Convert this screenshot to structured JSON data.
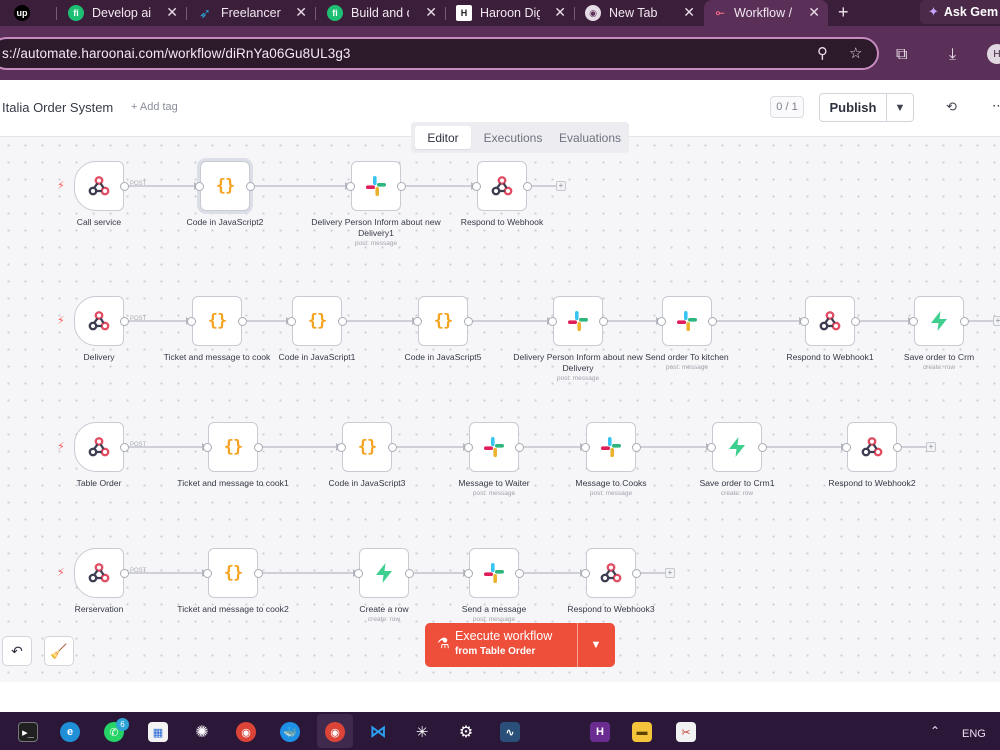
{
  "browser": {
    "tabs": [
      {
        "label": "",
        "icon": "upwork-icon",
        "favicon_text": "up"
      },
      {
        "label": "Develop ai",
        "icon": "fiverr-icon",
        "favicon_text": "fi"
      },
      {
        "label": "Freelancer",
        "icon": "freelancer-icon",
        "favicon_text": ""
      },
      {
        "label": "Build and d",
        "icon": "fiverr-icon",
        "favicon_text": "fi"
      },
      {
        "label": "Haroon Dig",
        "icon": "haroon-icon",
        "favicon_text": "H"
      },
      {
        "label": "New Tab",
        "icon": "chrome-icon",
        "favicon_text": ""
      },
      {
        "label": "Workflow /",
        "icon": "n8n-icon",
        "favicon_text": "",
        "active": true
      }
    ],
    "ask_gemini": "Ask Gem",
    "url": "s://automate.haroonai.com/workflow/diRnYa06Gu8UL3g3",
    "profile_initial": "H"
  },
  "header": {
    "workflow_name": "Italia Order System",
    "add_tag": "+ Add tag",
    "counter": "0 / 1",
    "publish": "Publish",
    "tabs": [
      "Editor",
      "Executions",
      "Evaluations"
    ],
    "active_tab": "Editor"
  },
  "workflow": {
    "edge_label": "POST",
    "nodes": [
      {
        "id": "n1",
        "label": "Call service",
        "type": "webhook",
        "trigger": true
      },
      {
        "id": "n2",
        "label": "Code in JavaScript2",
        "type": "code",
        "selected": true
      },
      {
        "id": "n3",
        "label": "Delivery Person Inform about new Delivery1",
        "type": "slack",
        "sub": "post: message"
      },
      {
        "id": "n4",
        "label": "Respond to Webhook",
        "type": "webhook"
      },
      {
        "id": "n5",
        "label": "Delivery",
        "type": "webhook",
        "trigger": true
      },
      {
        "id": "n6",
        "label": "Ticket and message to cook",
        "type": "code"
      },
      {
        "id": "n7",
        "label": "Code in JavaScript1",
        "type": "code"
      },
      {
        "id": "n8",
        "label": "Code in JavaScript5",
        "type": "code"
      },
      {
        "id": "n9",
        "label": "Delivery Person Inform about new Delivery",
        "type": "slack",
        "sub": "post: message"
      },
      {
        "id": "n10",
        "label": "Send order To kitchen",
        "type": "slack",
        "sub": "post: message"
      },
      {
        "id": "n11",
        "label": "Respond to Webhook1",
        "type": "webhook"
      },
      {
        "id": "n12",
        "label": "Save order to Crm",
        "type": "supabase",
        "sub": "create: row"
      },
      {
        "id": "n13",
        "label": "Table Order",
        "type": "webhook",
        "trigger": true
      },
      {
        "id": "n14",
        "label": "Ticket and message to cook1",
        "type": "code"
      },
      {
        "id": "n15",
        "label": "Code in JavaScript3",
        "type": "code"
      },
      {
        "id": "n16",
        "label": "Message to Waiter",
        "type": "slack",
        "sub": "post: message"
      },
      {
        "id": "n17",
        "label": "Message to Cooks",
        "type": "slack",
        "sub": "post: message"
      },
      {
        "id": "n18",
        "label": "Save order to Crm1",
        "type": "supabase",
        "sub": "create: row"
      },
      {
        "id": "n19",
        "label": "Respond to Webhook2",
        "type": "webhook"
      },
      {
        "id": "n20",
        "label": "Rerservation",
        "type": "webhook",
        "trigger": true
      },
      {
        "id": "n21",
        "label": "Ticket and message to cook2",
        "type": "code"
      },
      {
        "id": "n22",
        "label": "Create a row",
        "type": "supabase",
        "sub": "create: row"
      },
      {
        "id": "n23",
        "label": "Send a message",
        "type": "slack",
        "sub": "post: message"
      },
      {
        "id": "n24",
        "label": "Respond to Webhook3",
        "type": "webhook"
      }
    ]
  },
  "canvas_controls": {
    "undo": "undo-icon",
    "tidy": "broom-icon"
  },
  "execute": {
    "line1": "Execute workflow",
    "line2": "from Table Order"
  },
  "taskbar": {
    "whatsapp_badge": "6",
    "language": "ENG"
  },
  "colors": {
    "accent": "#ee4f3b",
    "browser_frame": "#5a2f58",
    "slack": [
      "#e01e5a",
      "#36c5f0",
      "#2eb67d",
      "#ecb22e"
    ],
    "supabase": "#3ecf8e",
    "webhook": "#e04d63"
  }
}
